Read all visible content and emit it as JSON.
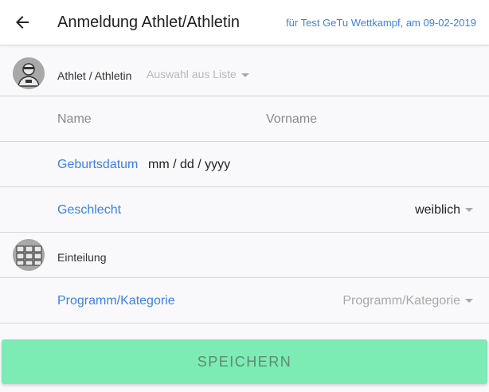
{
  "header": {
    "title": "Anmeldung Athlet/Athletin",
    "subtitle": "für Test GeTu Wettkampf, am 09-02-2019"
  },
  "athlete": {
    "label": "Athlet / Athletin",
    "select_placeholder": "Auswahl aus Liste"
  },
  "name": {
    "lastname_placeholder": "Name",
    "firstname_placeholder": "Vorname"
  },
  "birthdate": {
    "label": "Geburtsdatum",
    "value": "mm / dd / yyyy"
  },
  "gender": {
    "label": "Geschlecht",
    "value": "weiblich"
  },
  "assignment": {
    "label": "Einteilung"
  },
  "program": {
    "label": "Programm/Kategorie",
    "select_placeholder": "Programm/Kategorie"
  },
  "actions": {
    "save_label": "SPEICHERN"
  },
  "colors": {
    "accent_blue": "#3b82e6",
    "save_button": "#7debb4"
  }
}
